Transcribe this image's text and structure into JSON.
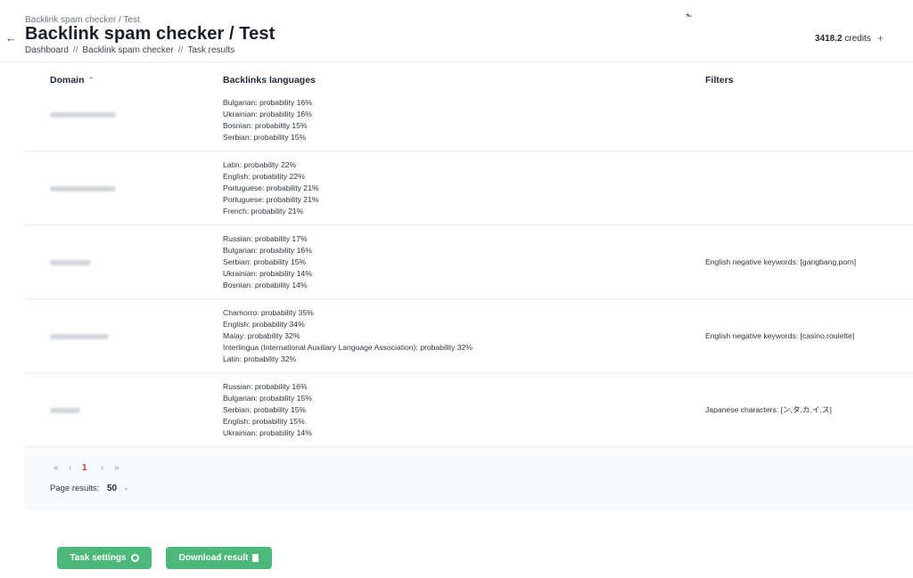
{
  "header": {
    "back_icon": "arrow-left-icon",
    "crumb_top": "Backlink spam checker / Test",
    "title": "Backlink spam checker / Test",
    "breadcrumb": [
      "Dashboard",
      "Backlink spam checker",
      "Task results"
    ],
    "breadcrumb_sep": "//",
    "cursor_glyph": "⬑",
    "credits_value": "3418.2",
    "credits_label": " credits",
    "plus_label": "+"
  },
  "table": {
    "columns": {
      "domain": "Domain",
      "domain_sort_icon": "chevron-up-icon",
      "languages": "Backlinks languages",
      "filters": "Filters"
    },
    "rows": [
      {
        "languages": [
          "Bulgarian: probability 16%",
          "Ukrainian: probability 16%",
          "Bosnian: probability 15%",
          "Serbian: probability 15%"
        ],
        "filter": ""
      },
      {
        "languages": [
          "Latin: probability 22%",
          "English: probability 22%",
          "Portuguese: probability 21%",
          "Portuguese: probability 21%",
          "French: probability 21%"
        ],
        "filter": ""
      },
      {
        "languages": [
          "Russian: probability 17%",
          "Bulgarian: probability 16%",
          "Serbian: probability 15%",
          "Ukrainian: probability 14%",
          "Bosnian: probability 14%"
        ],
        "filter": "English negative keywords: [gangbang,porn]"
      },
      {
        "languages": [
          "Chamorro: probability 35%",
          "English: probability 34%",
          "Malay: probability 32%",
          "Interlingua (International Auxiliary Language Association): probability 32%",
          "Latin: probability 32%"
        ],
        "filter": "English negative keywords: [casino,roulette]"
      },
      {
        "languages": [
          "Russian: probability 16%",
          "Bulgarian: probability 15%",
          "Serbian: probability 15%",
          "English: probability 15%",
          "Ukrainian: probability 14%"
        ],
        "filter": "Japanese characters: [ン,タ,カ,イ,ス]"
      }
    ]
  },
  "pagination": {
    "first": "«",
    "prev": "‹",
    "current": "1",
    "next": "›",
    "last": "»",
    "page_results_label": "Page results:",
    "page_results_value": "50",
    "page_results_icon": "chevron-down-icon"
  },
  "actions": {
    "task_settings": "Task settings",
    "task_settings_icon": "gear-icon",
    "download_result": "Download result",
    "download_result_icon": "document-icon"
  },
  "colors": {
    "accent_green": "#4cb87a",
    "current_page": "#c0392b",
    "panel_bg": "#f7fafc"
  }
}
